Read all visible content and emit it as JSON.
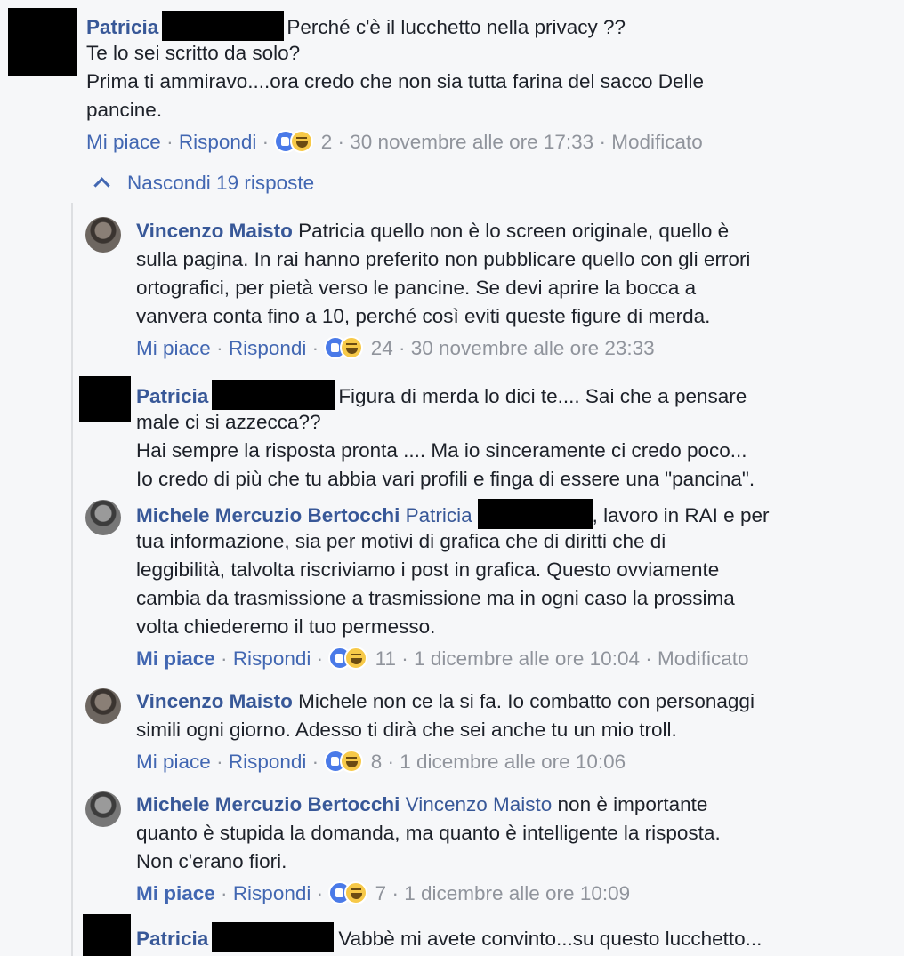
{
  "comments": [
    {
      "author": "Patricia",
      "lines": [
        "Perché c'è il lucchetto nella privacy ??",
        "Te lo sei scritto da solo?",
        "Prima ti ammiravo....ora credo che non sia tutta farina del sacco Delle",
        "pancine."
      ],
      "like_label": "Mi piace",
      "reply_label": "Rispondi",
      "reactions": "2",
      "timestamp": "30 novembre alle ore 17:33",
      "edited": "Modificato"
    }
  ],
  "toggle_replies": "Nascondi 19 risposte",
  "replies": [
    {
      "author": "Vincenzo Maisto",
      "lines": [
        "Patricia quello non è lo screen originale, quello è",
        "sulla pagina. In rai hanno preferito non pubblicare quello con gli errori",
        "ortografici, per pietà verso le pancine. Se devi aprire la bocca a",
        "vanvera conta fino a 10, perché così eviti queste figure di merda."
      ],
      "like_label": "Mi piace",
      "reply_label": "Rispondi",
      "reactions": "24",
      "timestamp": "30 novembre alle ore 23:33"
    },
    {
      "author": "Patricia",
      "lines": [
        "Figura di merda lo dici te.... Sai che a pensare",
        "male ci si azzecca??",
        "Hai sempre la risposta pronta .... Ma io sinceramente ci credo poco...",
        "Io credo di più che tu abbia vari profili e finga di essere una \"pancina\"."
      ]
    },
    {
      "author": "Michele Mercuzio Bertocchi",
      "lines": [
        "Patricia",
        ", lavoro in RAI e per",
        "tua informazione, sia per motivi di grafica che di diritti che di",
        "leggibilità, talvolta riscriviamo i post in grafica. Questo ovviamente",
        "cambia da trasmissione a trasmissione ma in ogni caso la prossima",
        "volta chiederemo il tuo permesso."
      ],
      "like_label": "Mi piace",
      "reply_label": "Rispondi",
      "reactions": "11",
      "timestamp": "1 dicembre alle ore 10:04",
      "edited": "Modificato"
    },
    {
      "author": "Vincenzo Maisto",
      "lines": [
        "Michele non ce la si fa. Io combatto con personaggi",
        "simili ogni giorno. Adesso ti dirà che sei anche tu un mio troll."
      ],
      "like_label": "Mi piace",
      "reply_label": "Rispondi",
      "reactions": "8",
      "timestamp": "1 dicembre alle ore 10:06"
    },
    {
      "author": "Michele Mercuzio Bertocchi",
      "mention": "Vincenzo Maisto",
      "lines": [
        "non è importante",
        "quanto è stupida la domanda, ma quanto è intelligente la risposta.",
        "Non c'erano fiori."
      ],
      "like_label": "Mi piace",
      "reply_label": "Rispondi",
      "reactions": "7",
      "timestamp": "1 dicembre alle ore 10:09"
    },
    {
      "author": "Patricia",
      "lines": [
        "Vabbè mi avete convinto...su questo lucchetto..."
      ]
    }
  ],
  "separator": "·",
  "colors": {
    "name": "#385898",
    "link": "#4267b2",
    "meta": "#90949c",
    "background": "#f6f7f9"
  }
}
